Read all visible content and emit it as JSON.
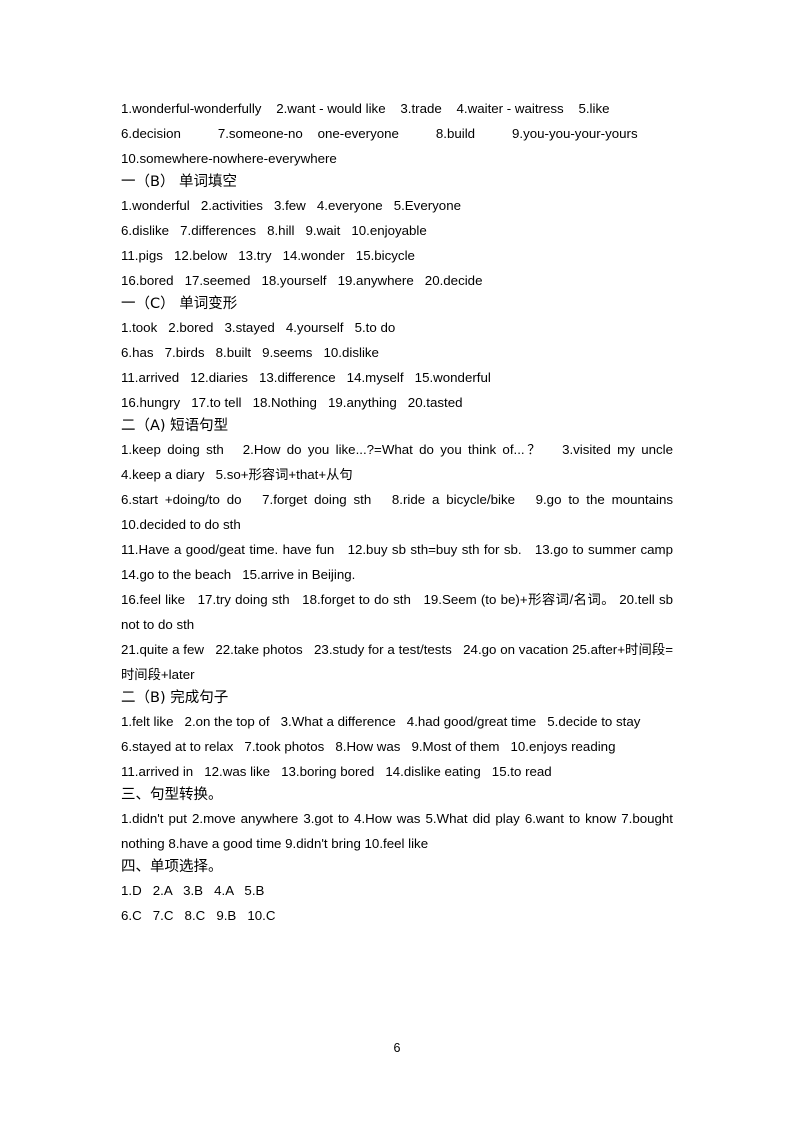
{
  "document": {
    "page_number": "6",
    "blocks": [
      {
        "type": "paragraph",
        "name": "answers-section-1a-line-1",
        "justify": true,
        "text": "1.wonderful-wonderfully    2.want - would like    3.trade    4.waiter - waitress    5.like"
      },
      {
        "type": "paragraph",
        "name": "answers-section-1a-line-2",
        "justify": true,
        "text": "6.decision          7.someone-no    one-everyone          8.build          9.you-you-your-yours"
      },
      {
        "type": "paragraph",
        "name": "answers-section-1a-line-3",
        "justify": false,
        "text": "10.somewhere-nowhere-everywhere"
      },
      {
        "type": "heading",
        "name": "heading-section-1b",
        "text": "一（B） 单词填空"
      },
      {
        "type": "paragraph",
        "name": "answers-section-1b-line-1",
        "justify": false,
        "text": "1.wonderful   2.activities   3.few   4.everyone   5.Everyone"
      },
      {
        "type": "paragraph",
        "name": "answers-section-1b-line-2",
        "justify": false,
        "text": "6.dislike   7.differences   8.hill   9.wait   10.enjoyable"
      },
      {
        "type": "paragraph",
        "name": "answers-section-1b-line-3",
        "justify": false,
        "text": "11.pigs   12.below   13.try   14.wonder   15.bicycle"
      },
      {
        "type": "paragraph",
        "name": "answers-section-1b-line-4",
        "justify": false,
        "text": "16.bored   17.seemed   18.yourself   19.anywhere   20.decide"
      },
      {
        "type": "heading",
        "name": "heading-section-1c",
        "text": "一（C） 单词变形"
      },
      {
        "type": "paragraph",
        "name": "answers-section-1c-line-1",
        "justify": false,
        "text": "1.took   2.bored   3.stayed   4.yourself   5.to do"
      },
      {
        "type": "paragraph",
        "name": "answers-section-1c-line-2",
        "justify": false,
        "text": "6.has   7.birds   8.built   9.seems   10.dislike"
      },
      {
        "type": "paragraph",
        "name": "answers-section-1c-line-3",
        "justify": false,
        "text": "11.arrived   12.diaries   13.difference   14.myself   15.wonderful"
      },
      {
        "type": "paragraph",
        "name": "answers-section-1c-line-4",
        "justify": false,
        "text": "16.hungry   17.to tell   18.Nothing   19.anything   20.tasted"
      },
      {
        "type": "heading",
        "name": "heading-section-2a",
        "text": "二（A) 短语句型"
      },
      {
        "type": "paragraph",
        "name": "answers-section-2a-line-1",
        "justify": true,
        "text": "1.keep doing sth   2.How do you like...?=What do you think of...？   3.visited my uncle   4.keep a diary   5.so+形容词+that+从句"
      },
      {
        "type": "paragraph",
        "name": "answers-section-2a-line-2",
        "justify": true,
        "text": "6.start +doing/to do   7.forget doing sth   8.ride a bicycle/bike   9.go to the mountains   10.decided to do sth"
      },
      {
        "type": "paragraph",
        "name": "answers-section-2a-line-3",
        "justify": true,
        "text": "11.Have a good/geat time. have fun   12.buy sb sth=buy sth for sb.   13.go to summer camp   14.go to the beach   15.arrive in Beijing."
      },
      {
        "type": "paragraph",
        "name": "answers-section-2a-line-4",
        "justify": true,
        "text": "16.feel like   17.try doing sth   18.forget to do sth   19.Seem (to be)+形容词/名词。 20.tell sb not to do sth"
      },
      {
        "type": "paragraph",
        "name": "answers-section-2a-line-5",
        "justify": true,
        "text": "21.quite a few   22.take photos   23.study for a test/tests   24.go on vacation 25.after+时间段=时间段+later"
      },
      {
        "type": "heading",
        "name": "heading-section-2b",
        "text": "二（B) 完成句子"
      },
      {
        "type": "paragraph",
        "name": "answers-section-2b-line-1",
        "justify": true,
        "text": "1.felt like   2.on the top of   3.What a difference   4.had good/great time   5.decide to stay"
      },
      {
        "type": "paragraph",
        "name": "answers-section-2b-line-2",
        "justify": true,
        "text": "6.stayed at to relax   7.took photos   8.How was   9.Most of them   10.enjoys reading"
      },
      {
        "type": "paragraph",
        "name": "answers-section-2b-line-3",
        "justify": false,
        "text": "11.arrived in   12.was like   13.boring bored   14.dislike eating   15.to read"
      },
      {
        "type": "heading",
        "name": "heading-section-3",
        "text": "三、句型转换。"
      },
      {
        "type": "paragraph",
        "name": "answers-section-3-line-1",
        "justify": true,
        "text": "1.didn't put 2.move anywhere 3.got to 4.How was 5.What did play 6.want to know 7.bought nothing 8.have a good time 9.didn't bring 10.feel like"
      },
      {
        "type": "heading",
        "name": "heading-section-4",
        "text": "四、单项选择。"
      },
      {
        "type": "paragraph",
        "name": "answers-section-4-line-1",
        "justify": false,
        "text": "1.D   2.A   3.B   4.A   5.B"
      },
      {
        "type": "paragraph",
        "name": "answers-section-4-line-2",
        "justify": false,
        "text": "6.C   7.C   8.C   9.B   10.C"
      }
    ]
  }
}
